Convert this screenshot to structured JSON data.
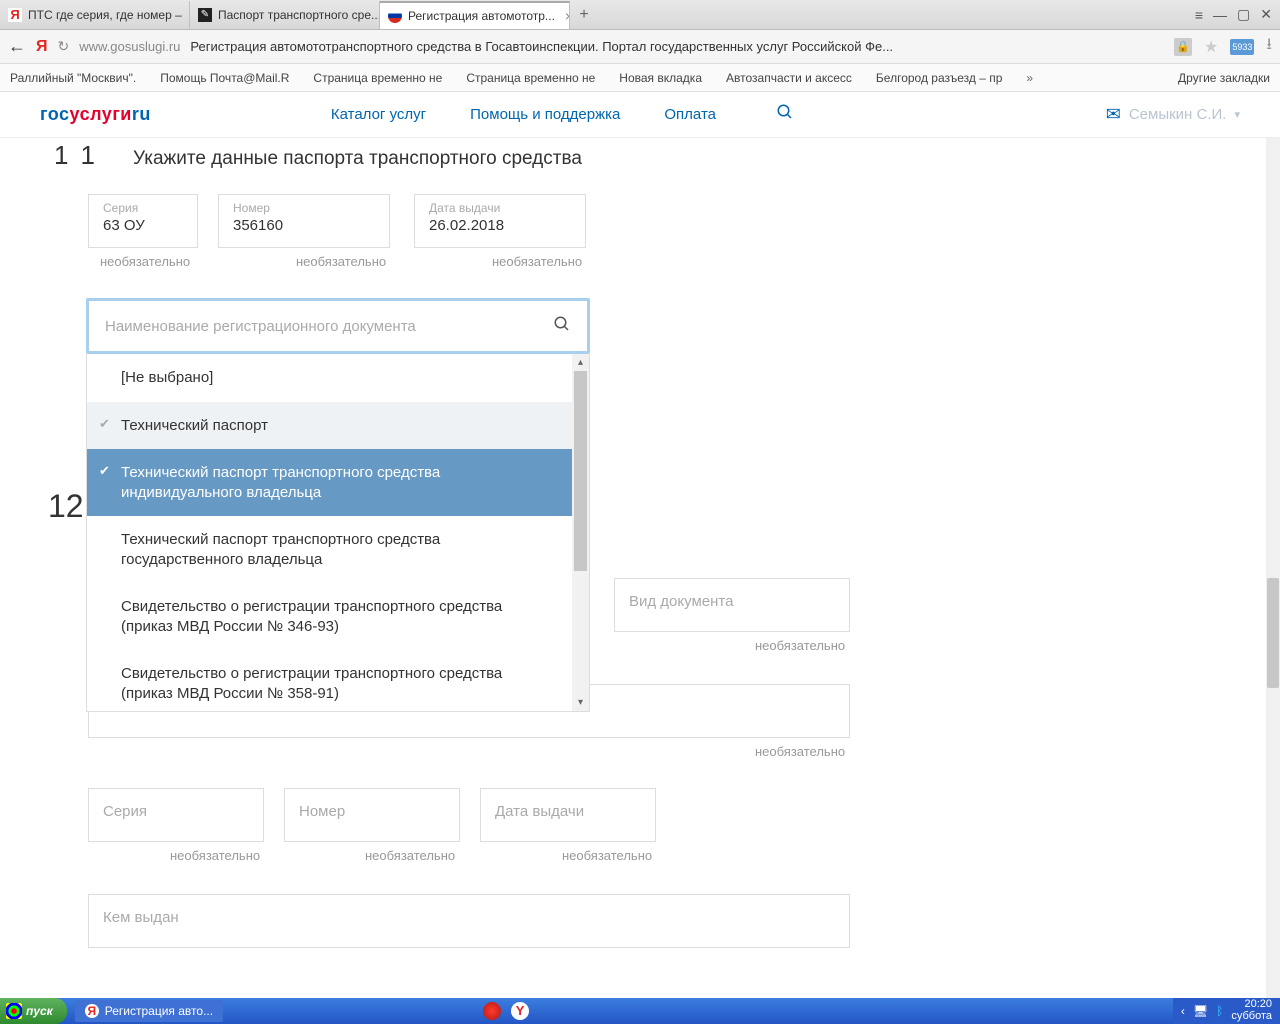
{
  "browser": {
    "tabs": [
      {
        "title": "ПТС где серия, где номер –"
      },
      {
        "title": "Паспорт транспортного сре..."
      },
      {
        "title": "Регистрация автомототр..."
      }
    ],
    "hamburger": "≡",
    "minimize": "—",
    "maximize": "▢",
    "close": "✕",
    "back": "←",
    "reload": "↻",
    "host": "www.gosuslugi.ru",
    "page_title": "Регистрация автомототранспортного средства в Госавтоинспекции. Портал государственных услуг Российской Фе...",
    "ext_label": "5933",
    "download": "⭳",
    "bookmarks": [
      "Раллийный \"Москвич\".",
      "Помощь Почта@Mail.R",
      "Страница временно не",
      "Страница временно не",
      "Новая вкладка",
      "Автозапчасти и аксесс",
      "Белгород разъезд – пр"
    ],
    "bookmarks_more": "»",
    "other_bookmarks": "Другие закладки"
  },
  "site": {
    "logo": {
      "p1": "гос",
      "p2": "услуги",
      "p3": "ru"
    },
    "nav": [
      "Каталог услуг",
      "Помощь и поддержка",
      "Оплата"
    ],
    "user": "Семыкин С.И."
  },
  "section11": {
    "number": "11",
    "title": "Укажите данные паспорта транспортного средства",
    "seria": {
      "label": "Серия",
      "value": "63 ОУ",
      "hint": "необязательно"
    },
    "nomer": {
      "label": "Номер",
      "value": "356160",
      "hint": "необязательно"
    },
    "date": {
      "label": "Дата выдачи",
      "value": "26.02.2018",
      "hint": "необязательно"
    }
  },
  "dropdown": {
    "placeholder": "Наименование регистрационного документа",
    "items": [
      "[Не выбрано]",
      "Технический паспорт",
      "Технический паспорт транспортного средства индивидуального владельца",
      "Технический паспорт транспортного средства государственного владельца",
      "Свидетельство о регистрации транспортного средства (приказ МВД России № 346-93)",
      "Свидетельство о регистрации транспортного средства (приказ МВД России № 358-91)"
    ]
  },
  "section12": {
    "number": "12",
    "vid": {
      "placeholder": "Вид документа",
      "hint": "необязательно"
    },
    "big_hint": "необязательно",
    "seria": {
      "placeholder": "Серия",
      "hint": "необязательно"
    },
    "nomer": {
      "placeholder": "Номер",
      "hint": "необязательно"
    },
    "date": {
      "placeholder": "Дата выдачи",
      "hint": "необязательно"
    },
    "kem": {
      "placeholder": "Кем выдан"
    }
  },
  "taskbar": {
    "start": "пуск",
    "task": "Регистрация авто...",
    "time": "20:20",
    "day": "суббота"
  }
}
